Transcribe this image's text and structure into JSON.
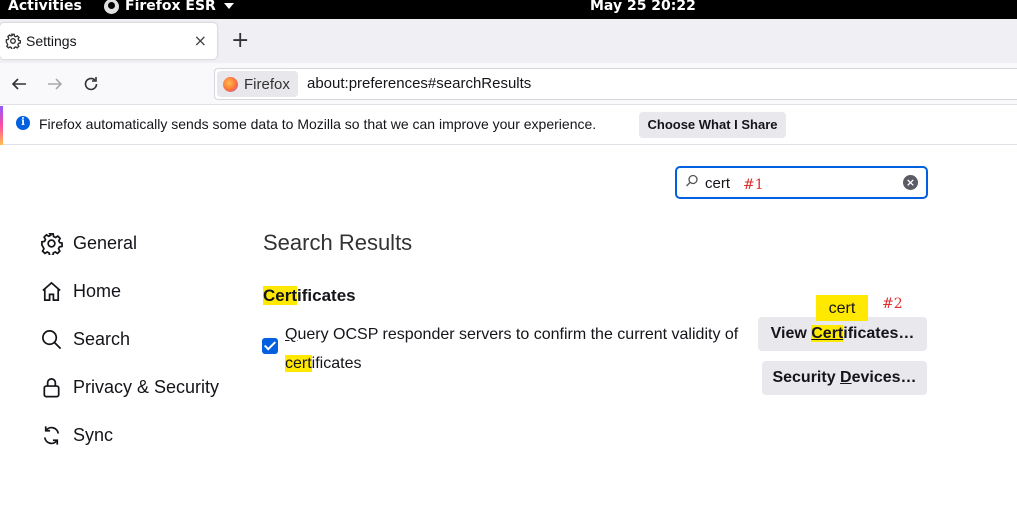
{
  "topbar": {
    "activities": "Activities",
    "app_name": "Firefox ESR",
    "clock": "May 25  20:22"
  },
  "tab": {
    "title": "Settings",
    "close": "×",
    "new_tab": "+"
  },
  "navbar": {
    "identity_label": "Firefox",
    "url": "about:preferences#searchResults"
  },
  "notification": {
    "message": "Firefox automatically sends some data to Mozilla so that we can improve your experience.",
    "button": "Choose What I Share"
  },
  "search": {
    "value": "cert"
  },
  "markers": {
    "m1": "#1",
    "m2": "#2"
  },
  "sidebar": {
    "items": [
      {
        "label": "General",
        "icon": "gear-icon"
      },
      {
        "label": "Home",
        "icon": "home-icon"
      },
      {
        "label": "Search",
        "icon": "search-icon"
      },
      {
        "label": "Privacy & Security",
        "icon": "lock-icon"
      },
      {
        "label": "Sync",
        "icon": "sync-icon"
      }
    ]
  },
  "main": {
    "heading": "Search Results",
    "group": {
      "title_match": "Cert",
      "title_rest": "ificates"
    },
    "ocsp": {
      "checked": true,
      "first_letter": "Q",
      "text1": "uery OCSP responder servers to confirm the current validity of",
      "match": "cert",
      "text2": "ificates"
    },
    "view_certs": {
      "pre": "View ",
      "match": "Cert",
      "post": "ificates…"
    },
    "security_devices": {
      "pre": "Security ",
      "accel": "D",
      "post": "evices…"
    },
    "tooltip": "cert"
  },
  "colors": {
    "accent": "#0060df",
    "highlight": "#ffe900"
  }
}
